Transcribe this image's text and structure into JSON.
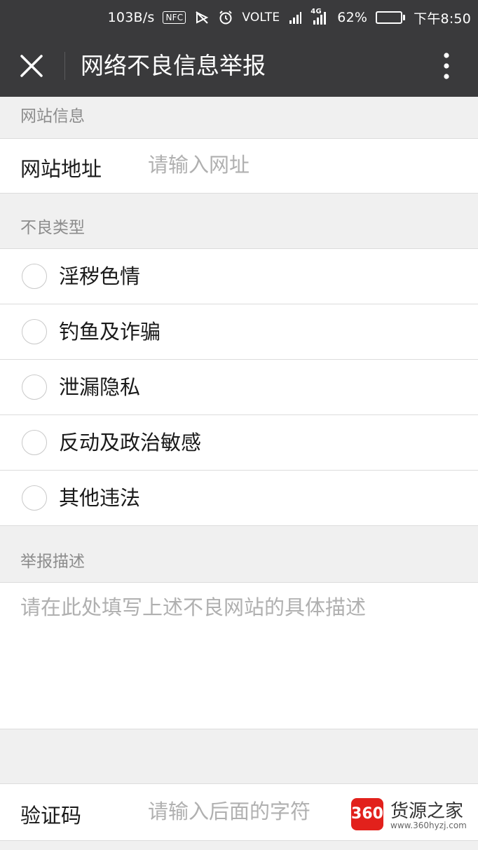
{
  "status_bar": {
    "speed": "103B/s",
    "nfc": "NFC",
    "volte": "VOLTE",
    "network": "4G",
    "battery": "62%",
    "battery_level": 0.62,
    "time": "下午8:50"
  },
  "app_bar": {
    "title": "网络不良信息举报",
    "close_icon": "close-icon",
    "more_icon": "more-vert-icon"
  },
  "website_section": {
    "header": "网站信息",
    "url_label": "网站地址",
    "url_placeholder": "请输入网址"
  },
  "type_section": {
    "header": "不良类型",
    "options": [
      {
        "label": "淫秽色情",
        "selected": false
      },
      {
        "label": "钓鱼及诈骗",
        "selected": false
      },
      {
        "label": "泄漏隐私",
        "selected": false
      },
      {
        "label": "反动及政治敏感",
        "selected": false
      },
      {
        "label": "其他违法",
        "selected": false
      }
    ]
  },
  "description_section": {
    "header": "举报描述",
    "placeholder": "请在此处填写上述不良网站的具体描述"
  },
  "captcha": {
    "label": "验证码",
    "placeholder": "请输入后面的字符"
  },
  "watermark": {
    "logo_text": "360",
    "name": "货源之家",
    "url": "www.360hyzj.com"
  },
  "colors": {
    "app_bar_bg": "#3a3a3c",
    "page_bg": "#f0f0f0",
    "battery_fill": "#5bd35b",
    "watermark_red": "#e2211c"
  }
}
